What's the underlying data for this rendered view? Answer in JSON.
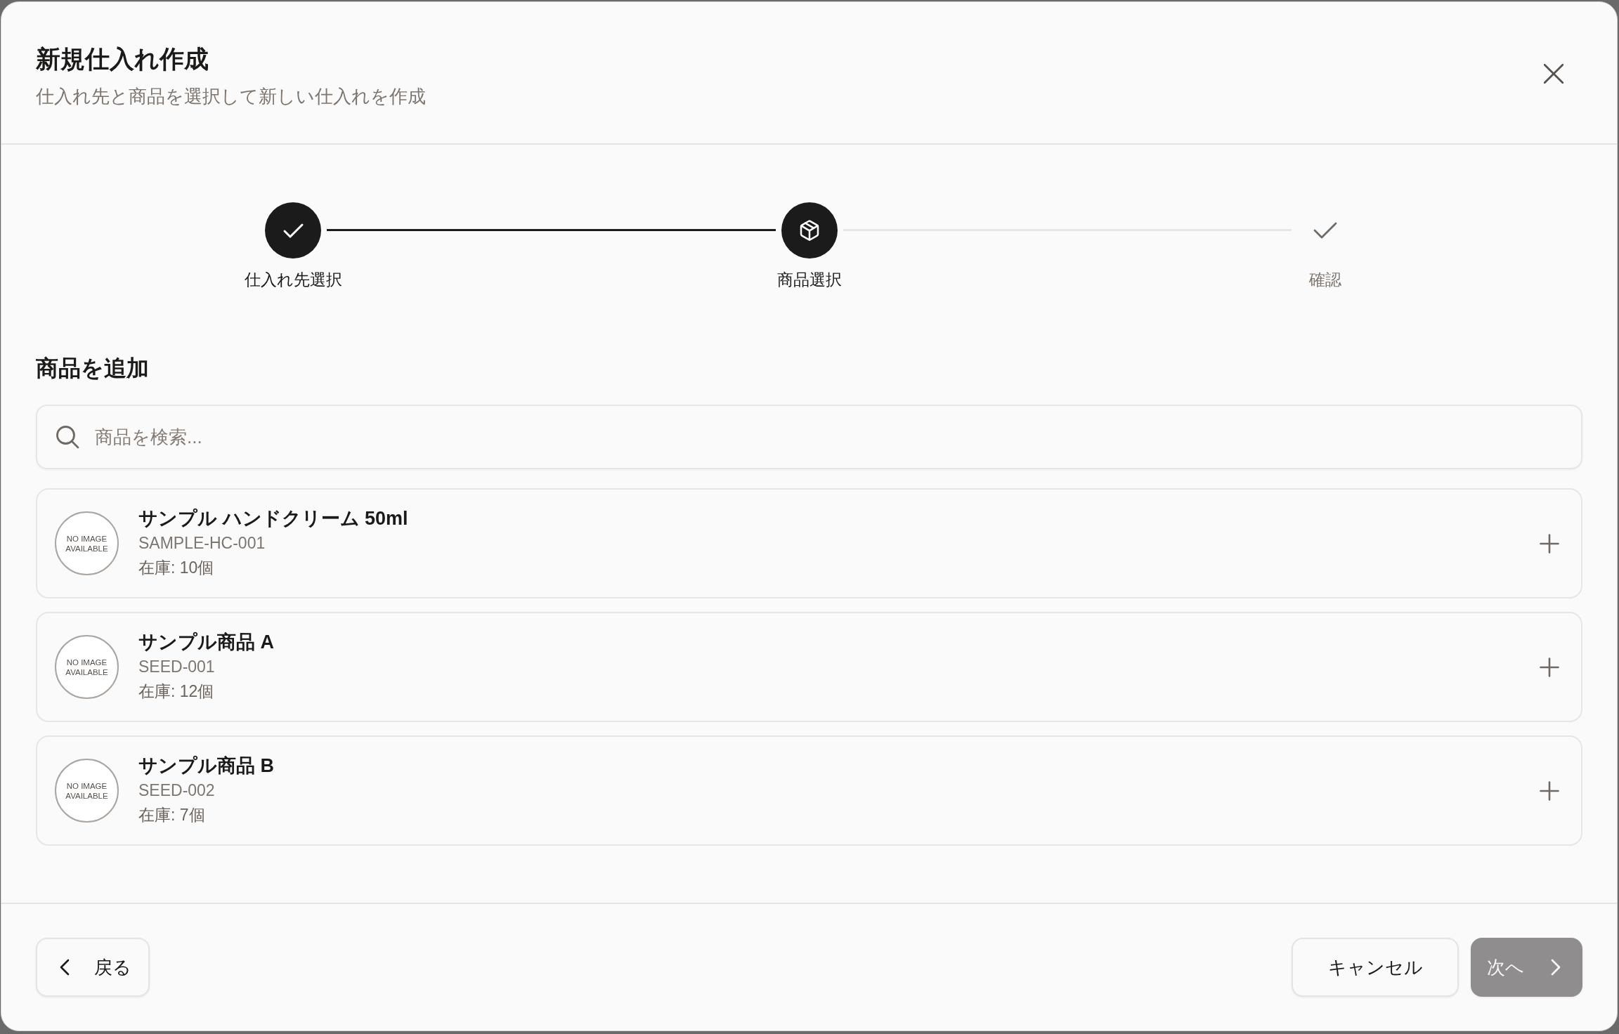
{
  "dialog": {
    "title": "新規仕入れ作成",
    "subtitle": "仕入れ先と商品を選択して新しい仕入れを作成",
    "steps": [
      {
        "label": "仕入れ先選択",
        "kind": "done"
      },
      {
        "label": "商品選択",
        "kind": "current"
      },
      {
        "label": "確認",
        "kind": "pending"
      }
    ],
    "section_title": "商品を追加",
    "search": {
      "placeholder": "商品を検索..."
    },
    "products": [
      {
        "thumbnail_text": "NO IMAGE AVAILABLE",
        "name": "サンプル ハンドクリーム 50ml",
        "sku": "SAMPLE-HC-001",
        "stock": "在庫: 10個"
      },
      {
        "thumbnail_text": "NO IMAGE AVAILABLE",
        "name": "サンプル商品 A",
        "sku": "SEED-001",
        "stock": "在庫: 12個"
      },
      {
        "thumbnail_text": "NO IMAGE AVAILABLE",
        "name": "サンプル商品 B",
        "sku": "SEED-002",
        "stock": "在庫: 7個"
      }
    ],
    "footer": {
      "back_button": "戻る",
      "cancel_button": "キャンセル",
      "next_button": {
        "label": "次へ",
        "disabled": true
      }
    }
  }
}
